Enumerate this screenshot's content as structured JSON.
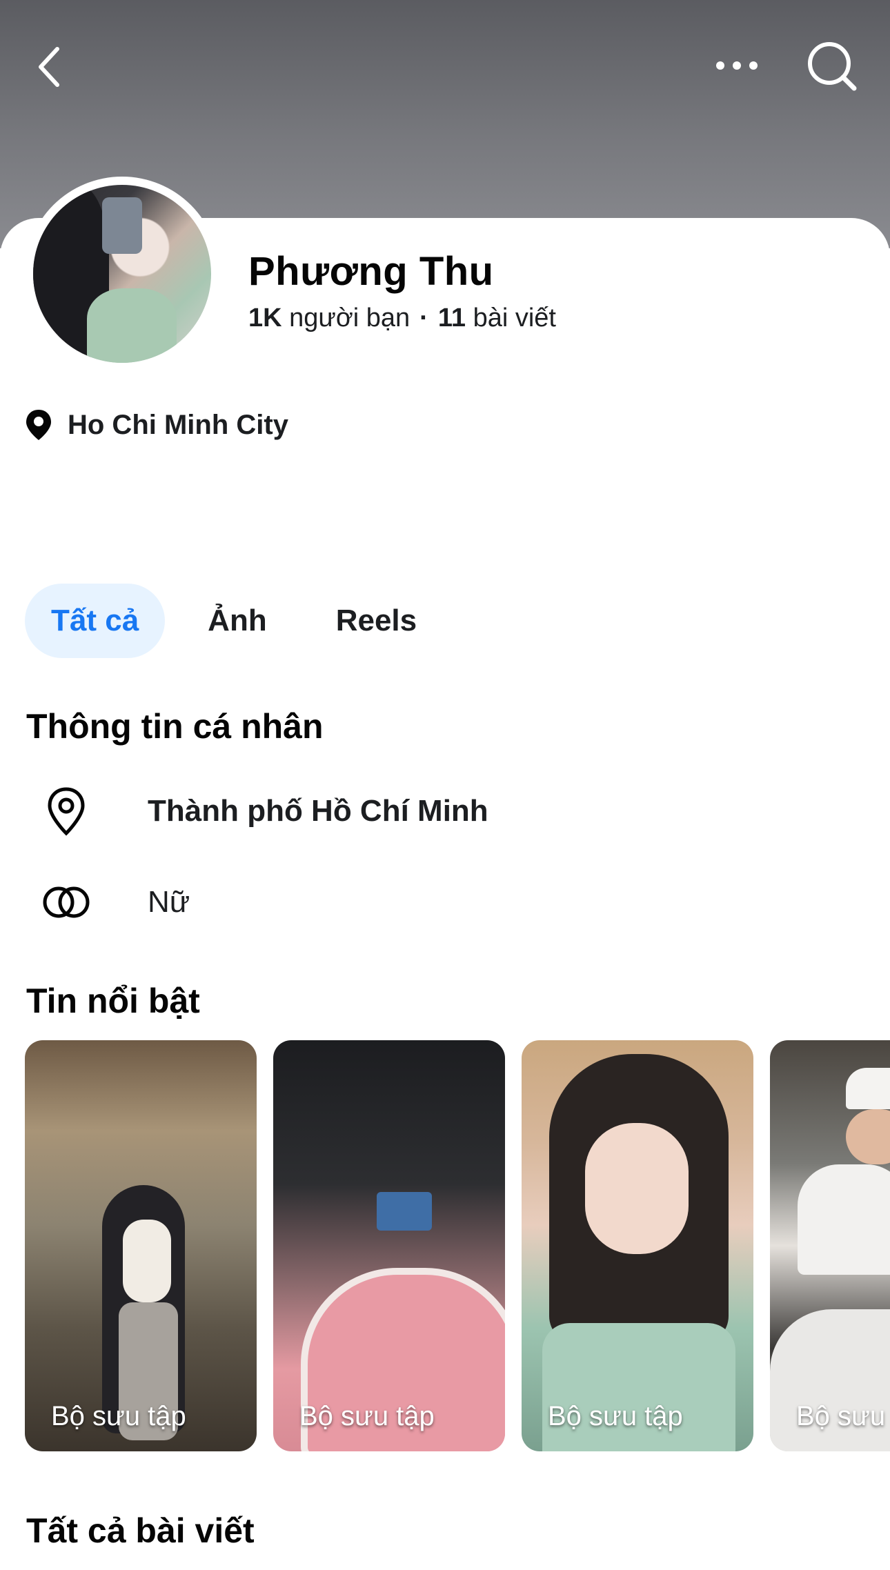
{
  "colors": {
    "accent": "#1877f2",
    "active_tab_bg": "#e7f3ff",
    "text": "#050505",
    "cover": "#6f7075"
  },
  "header": {
    "back_icon": "chevron-left-icon",
    "more_icon": "more-horizontal-icon",
    "search_icon": "search-icon"
  },
  "profile": {
    "name": "Phương Thu",
    "friends_count": "1K",
    "friends_label": "người bạn",
    "posts_count": "11",
    "posts_label": "bài viết",
    "location": "Ho Chi Minh City"
  },
  "tabs": [
    {
      "label": "Tất cả",
      "active": true
    },
    {
      "label": "Ảnh",
      "active": false
    },
    {
      "label": "Reels",
      "active": false
    }
  ],
  "personal_info": {
    "title": "Thông tin cá nhân",
    "items": [
      {
        "icon": "location-pin-icon",
        "text": "Thành phố Hồ Chí Minh"
      },
      {
        "icon": "gender-rings-icon",
        "text": "Nữ"
      }
    ]
  },
  "highlights": {
    "title": "Tin nổi bật",
    "items": [
      {
        "label": "Bộ sưu tập"
      },
      {
        "label": "Bộ sưu tập"
      },
      {
        "label": "Bộ sưu tập"
      },
      {
        "label": "Bộ sưu"
      }
    ]
  },
  "all_posts": {
    "title": "Tất cả bài viết"
  }
}
